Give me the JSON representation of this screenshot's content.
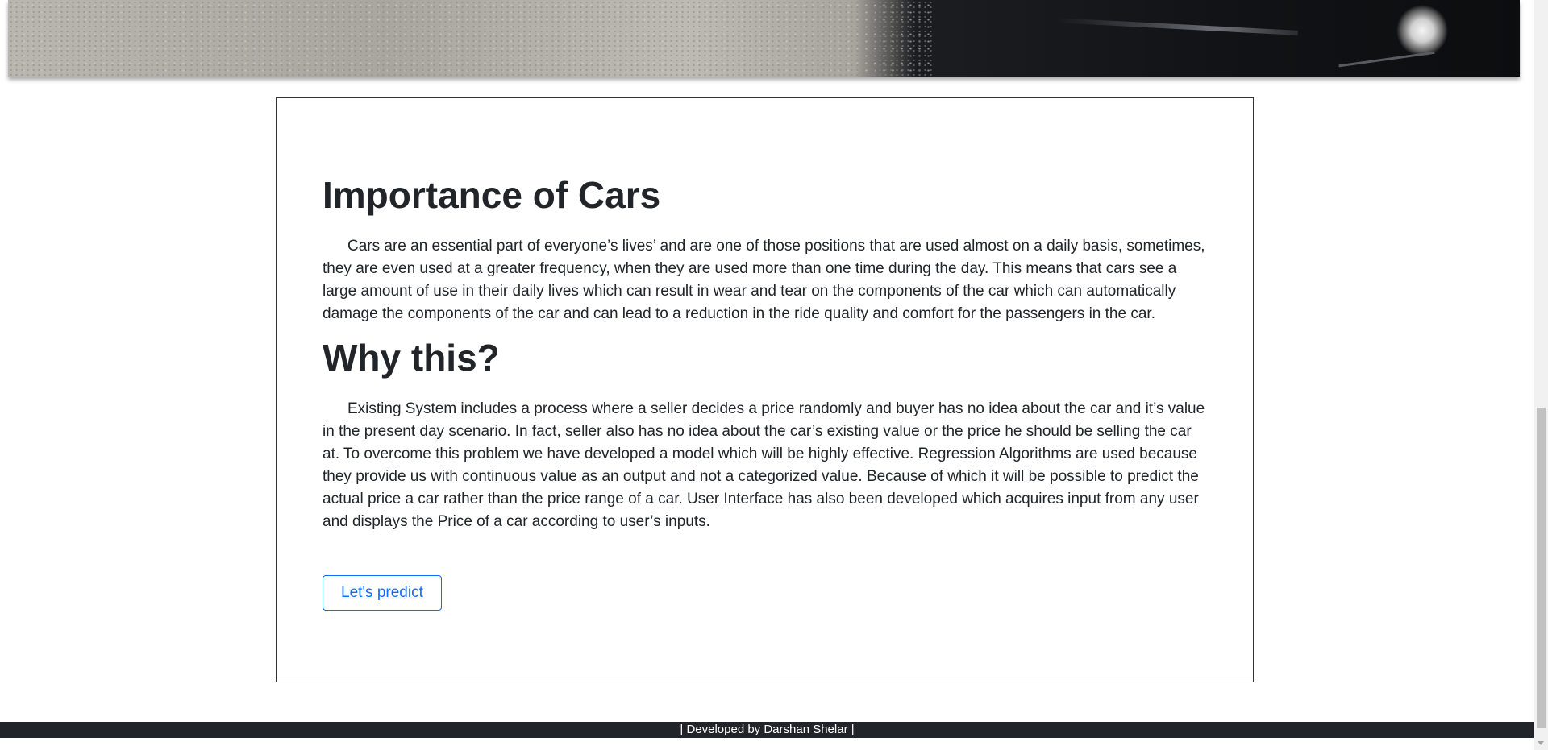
{
  "hero": {
    "image_name": "car-hero-image"
  },
  "sections": [
    {
      "heading": "Importance of Cars",
      "body": "Cars are an essential part of everyone’s lives’ and are one of those positions that are used almost on a daily basis, sometimes, they are even used at a greater frequency, when they are used more than one time during the day. This means that cars see a large amount of use in their daily lives which can result in wear and tear on the components of the car which can automatically damage the components of the car and can lead to a reduction in the ride quality and comfort for the passengers in the car."
    },
    {
      "heading": "Why this?",
      "body": "Existing System includes a process where a seller decides a price randomly and buyer has no idea about the car and it’s value in the present day scenario. In fact, seller also has no idea about the car’s existing value or the price he should be selling the car at. To overcome this problem we have developed a model which will be highly effective. Regression Algorithms are used because they provide us with continuous value as an output and not a categorized value. Because of which it will be possible to predict the actual price a car rather than the price range of a car. User Interface has also been developed which acquires input from any user and displays the Price of a car according to user’s inputs."
    }
  ],
  "predict_button": {
    "label": "Let's predict",
    "color": "#0d6efd"
  },
  "footer": {
    "text": "| Developed by Darshan Shelar |",
    "background": "#212529"
  }
}
